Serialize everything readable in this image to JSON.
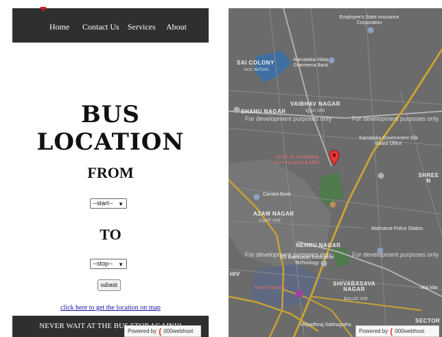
{
  "nav": {
    "items": [
      "Home",
      "Contact Us",
      "Services",
      "About"
    ]
  },
  "page": {
    "title": "BUS LOCATION",
    "from_label": "FROM",
    "to_label": "TO",
    "from_select": "--start--",
    "to_select": "--stop--",
    "submit_label": "submit",
    "map_link": "click here to get the location on map",
    "footer_text": "NEVER WAIT AT THE BUS STOP AGAIN!!!"
  },
  "badge": {
    "text": "Powered by",
    "brand": "000webhost"
  },
  "map": {
    "watermark": "For development purposes only",
    "labels": {
      "employees": "Employee's State Insurance Corporation",
      "sai_colony": "SAI COLONY",
      "sai_colony_kn": "ಸಾಯಿ ಕಾಲೋನಿ",
      "karnataka_vikas": "Karnataka Vikas Grameena Bank",
      "vaibhav_nagar": "VAIBHAV NAGAR",
      "vaibhav_nagar_kn": "ವೈಭವ ನಗರ",
      "shahu_nagar": "SHAHU NAGAR",
      "silk_board": "Karnataka Government Silk Board Office",
      "kles": "KLES Dr. Prabhakar Kore Hospital & MRC",
      "shree_n": "SHREE N",
      "canara": "Canara Bank",
      "azam_nagar": "AZAM NAGAR",
      "azam_nagar_kn": "ಅಜಮ್ ನಗರ",
      "malmaruti": "Malmaruti Police Station",
      "nehru_nagar": "NEHRU NAGAR",
      "sg_balekundri": "SG Balekundri Institute of Technology",
      "shivabasava": "SHIVABASAVA NAGAR",
      "shivabasava_kn": "ಶಿವಬಸವ ನಗರ",
      "ramdev": "Hotel Ramdev",
      "vidyadhiraj": "Vidyadhiraj Sabhagraha",
      "mal_mar": "Mal Mar",
      "sector": "SECTOR",
      "hiv": "HIV"
    }
  },
  "colors": {
    "nav_bg": "#2f2f2f",
    "map_bg": "#6b6b6b",
    "road_yellow": "#c9a233",
    "pin_red": "#e53935",
    "link": "#1a0dab"
  }
}
